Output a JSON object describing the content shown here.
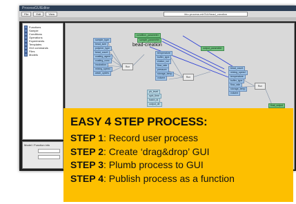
{
  "window": {
    "title": "ProcessGUIEditor",
    "menu": [
      "File",
      "Edit",
      "View"
    ],
    "path": "/bio-process-ml/GUI/bead_creation"
  },
  "sidebar": {
    "items": [
      "Functions",
      "Sample",
      "Conditions",
      "Operations",
      "Experiments",
      "Templates",
      "GUI commands",
      "Files",
      "Models"
    ]
  },
  "lower_panel": {
    "title": "Model / Function info"
  },
  "canvas": {
    "process_label": "bead-creation",
    "nodes_blue": [
      "sample_type",
      "bead_size",
      "polymer_type",
      "bead_count",
      "coating_agent",
      "coating_conc",
      "incubation",
      "mixing_speed",
      "wash_cycles",
      "temperature",
      "buffer_type",
      "elution_vol",
      "flow_rate",
      "pressure",
      "storage_temp",
      "volume",
      "ph_level",
      "spin_time",
      "batch_id",
      "output_dir"
    ],
    "nodes_green": [
      "condition_parameter",
      "sample_parameter",
      "output_parameter",
      "final_output"
    ],
    "step_label": "Run"
  },
  "callout": {
    "heading": "EASY 4 STEP PROCESS:",
    "steps": [
      {
        "label": "STEP 1",
        "text": ": Record user process"
      },
      {
        "label": "STEP 2",
        "text": ": Create ‘drag&drop’ GUI"
      },
      {
        "label": "STEP 3",
        "text": ": Plumb process to GUI"
      },
      {
        "label": "STEP 4",
        "text": ": Publish process as a function"
      }
    ]
  },
  "colors": {
    "callout_bg": "#fdbf00",
    "canvas_bg": "#d9d9d9",
    "node_blue": "#9fc3e6",
    "node_green": "#72c07f",
    "link_blue": "#2b3fd6"
  }
}
